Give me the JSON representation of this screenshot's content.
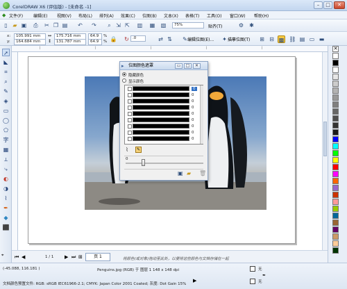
{
  "window": {
    "title": "CorelDRAW X6 (评估版) - [未命名 -1]",
    "min": "–",
    "max": "□",
    "close": "✕"
  },
  "menu": [
    "文件(F)",
    "编辑(E)",
    "视图(V)",
    "布局(L)",
    "排列(A)",
    "效果(C)",
    "位图(B)",
    "文本(X)",
    "表格(T)",
    "工具(O)",
    "窗口(W)",
    "帮助(H)"
  ],
  "toolbar1": {
    "zoom": "75%",
    "snap": "贴齐(T)"
  },
  "toolbar2": {
    "x": "105.991 mm",
    "y": "164.684 mm",
    "w": "175.716 mm",
    "h": "131.787 mm",
    "scale_w": "64.9",
    "scale_h": "64.9",
    "pct": "%",
    "angle": ".0",
    "edit_bitmap": "编辑位图(E)...",
    "trace_bitmap": "描摹位图(T)"
  },
  "dialog": {
    "title": "位图颜色遮罩",
    "hide_colors": "隐藏颜色",
    "show_colors": "显示颜色",
    "rows": [
      "0",
      "0",
      "0",
      "0",
      "0",
      "0",
      "0",
      "0",
      "0",
      "0"
    ],
    "tolerance": "0"
  },
  "page_nav": {
    "counter": "1 / 1",
    "tab": "页 1"
  },
  "status": {
    "hint": "将颜色(或对象)拖动至此处，以便将这些颜色与文档存储在一起",
    "coords": "(-45.088, 116.181 )",
    "object_info": "Penguins.jpg (RGB) 于 图层 1 148 x 148 dpi",
    "doc_profile": "文档颜色预置文件: RGB: sRGB IEC61966-2.1; CMYK: Japan Color 2001 Coated; 灰度: Dot Gain 15%",
    "fill_none": "无",
    "outline_none": "无"
  },
  "palette_colors": [
    "#ffffff",
    "#000000",
    "#ffffff",
    "#e6e6e6",
    "#cccccc",
    "#b3b3b3",
    "#999999",
    "#808080",
    "#666666",
    "#4d4d4d",
    "#333333",
    "#1a1a1a",
    "#0000ff",
    "#00ffff",
    "#00ff00",
    "#ffff00",
    "#ff0000",
    "#ff00ff",
    "#ff6600",
    "#9966cc",
    "#cc3300",
    "#ff9999",
    "#99cc00",
    "#006699",
    "#996633",
    "#660066",
    "#cc9966",
    "#ffcc99",
    "#003300"
  ]
}
